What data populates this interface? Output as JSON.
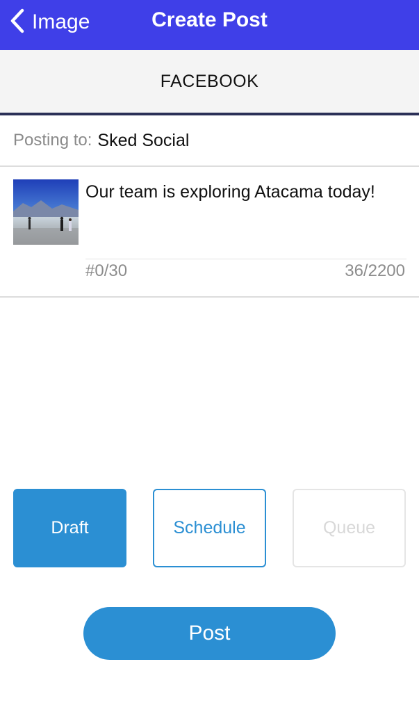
{
  "colors": {
    "navbar": "#3f3fe8",
    "accent": "#2b8fd3",
    "tab_underline": "#2b3057",
    "muted_text": "#8a8a8a",
    "disabled_text": "#d8d8d8"
  },
  "nav": {
    "back_icon": "chevron-left-icon",
    "back_label": "Image",
    "title": "Create Post"
  },
  "network": {
    "label": "FACEBOOK"
  },
  "posting": {
    "prefix": "Posting to:",
    "account": "Sked Social"
  },
  "compose": {
    "thumbnail": "landscape-photo-thumbnail",
    "caption": "Our team is exploring Atacama today!",
    "hashtag_count": "#0/30",
    "char_count": "36/2200"
  },
  "modes": {
    "draft": "Draft",
    "schedule": "Schedule",
    "queue": "Queue",
    "selected": "Draft"
  },
  "actions": {
    "post": "Post"
  }
}
